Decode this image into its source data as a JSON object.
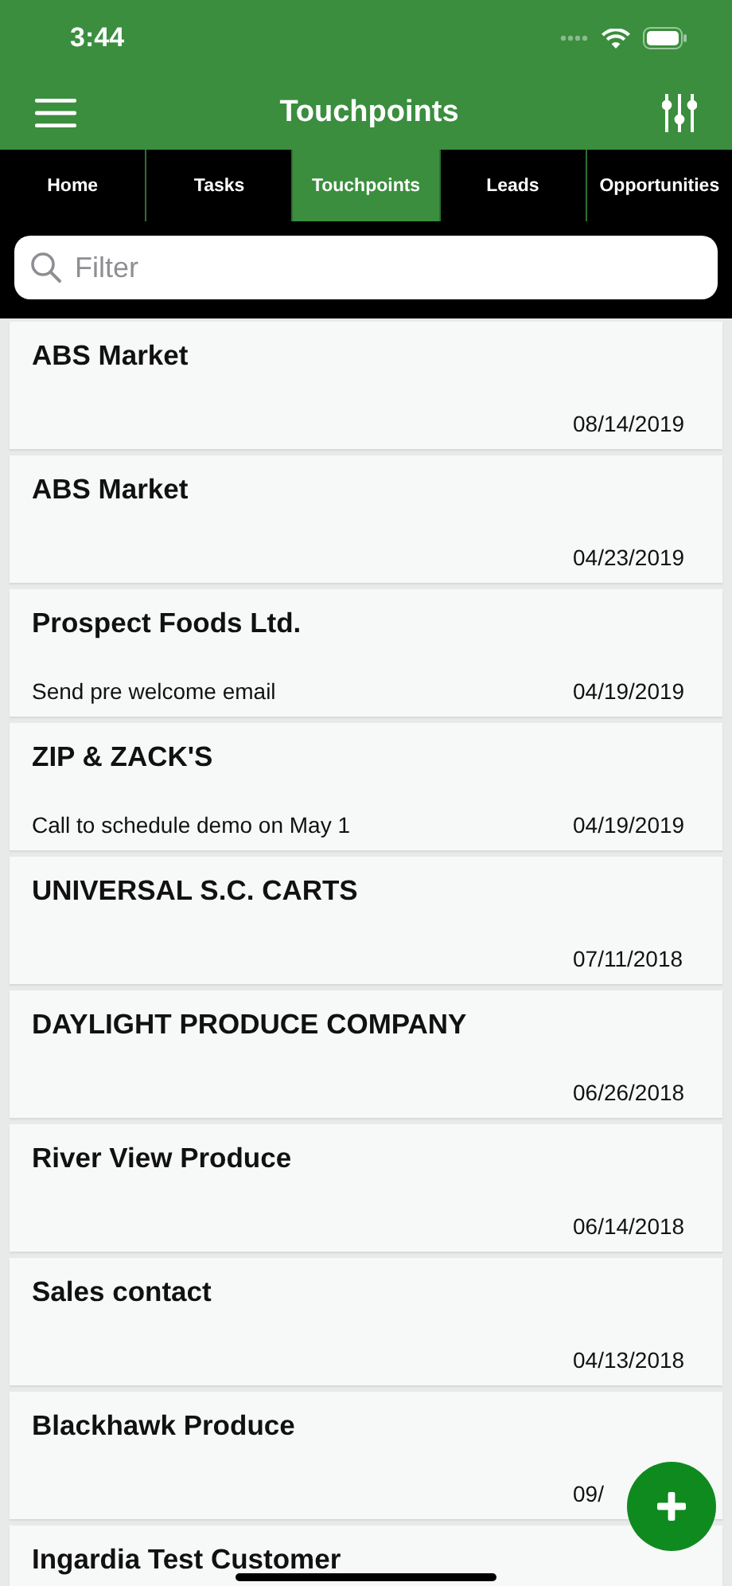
{
  "status_bar": {
    "time": "3:44"
  },
  "header": {
    "title": "Touchpoints"
  },
  "tabs": [
    {
      "label": "Home",
      "selected": false
    },
    {
      "label": "Tasks",
      "selected": false
    },
    {
      "label": "Touchpoints",
      "selected": true
    },
    {
      "label": "Leads",
      "selected": false
    },
    {
      "label": "Opportunities",
      "selected": false
    }
  ],
  "search": {
    "placeholder": "Filter"
  },
  "touchpoints": [
    {
      "name": "ABS Market",
      "date": "08/14/2019"
    },
    {
      "name": "ABS Market",
      "date": "04/23/2019"
    },
    {
      "name": "Prospect Foods Ltd.",
      "note": "Send pre welcome email",
      "date": "04/19/2019"
    },
    {
      "name": "ZIP & ZACK'S",
      "note": "Call to schedule demo on May 1",
      "date": "04/19/2019"
    },
    {
      "name": "UNIVERSAL S.C. CARTS",
      "date": "07/11/2018"
    },
    {
      "name": "DAYLIGHT PRODUCE COMPANY",
      "date": "06/26/2018"
    },
    {
      "name": "River View Produce",
      "date": "06/14/2018"
    },
    {
      "name": "Sales contact",
      "date": "04/13/2018"
    },
    {
      "name": "Blackhawk Produce",
      "date": "09/"
    },
    {
      "name": "Ingardia Test Customer"
    }
  ]
}
